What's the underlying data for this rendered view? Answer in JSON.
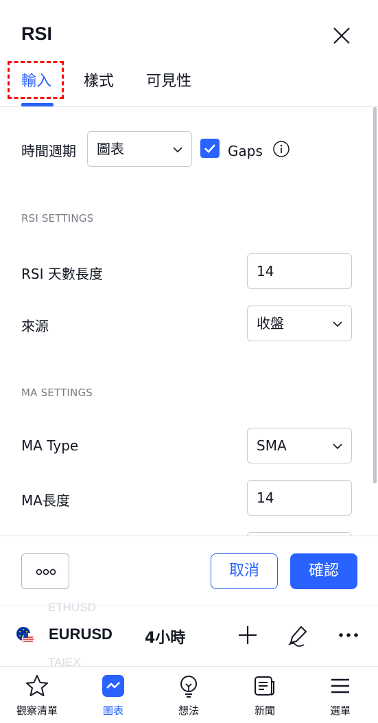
{
  "dialog": {
    "title": "RSI",
    "tabs": [
      "輸入",
      "樣式",
      "可見性"
    ],
    "active_tab": "輸入"
  },
  "inputs": {
    "timeframe_label": "時間週期",
    "timeframe_value": "圖表",
    "gaps_label": "Gaps",
    "gaps_checked": true,
    "rsi_section": "RSI SETTINGS",
    "rsi_length_label": "RSI 天數長度",
    "rsi_length_value": "14",
    "source_label": "來源",
    "source_value": "收盤",
    "ma_section": "MA SETTINGS",
    "ma_type_label": "MA Type",
    "ma_type_value": "SMA",
    "ma_length_label": "MA長度",
    "ma_length_value": "14"
  },
  "footer": {
    "more_label": "○○○",
    "cancel_label": "取消",
    "ok_label": "確認"
  },
  "symbol_bar": {
    "ghost_above": "ETHUSD",
    "ghost_below": "TAIEX",
    "symbol": "EURUSD",
    "interval": "4小時"
  },
  "bottom_nav": [
    {
      "label": "觀察清單",
      "icon": "star-icon"
    },
    {
      "label": "圖表",
      "icon": "chart-icon"
    },
    {
      "label": "想法",
      "icon": "lightbulb-icon"
    },
    {
      "label": "新聞",
      "icon": "news-icon"
    },
    {
      "label": "選單",
      "icon": "menu-icon"
    }
  ],
  "colors": {
    "accent": "#2962ff",
    "text": "#131722",
    "muted": "#787b86",
    "highlight_box": "#ff0000"
  }
}
